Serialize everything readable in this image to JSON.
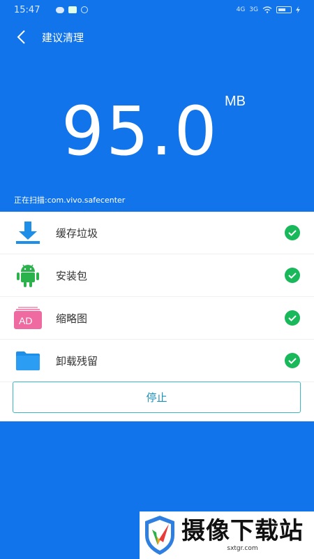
{
  "status_bar": {
    "time": "15:47",
    "net1": "4G",
    "net2": "3G"
  },
  "header": {
    "title": "建议清理"
  },
  "scan": {
    "size_value": "95.0",
    "size_unit": "MB",
    "status_text": "正在扫描:com.vivo.safecenter"
  },
  "items": [
    {
      "label": "缓存垃圾",
      "icon": "download-icon"
    },
    {
      "label": "安装包",
      "icon": "android-icon"
    },
    {
      "label": "缩略图",
      "icon": "ad-thumbnail-icon",
      "icon_text": "AD"
    },
    {
      "label": "卸载残留",
      "icon": "folder-icon"
    }
  ],
  "stop_button": {
    "label": "停止"
  },
  "watermark": {
    "title": "摄像下载站",
    "url": "sxtgr.com"
  },
  "colors": {
    "primary": "#1274ea",
    "check": "#19b85a",
    "button_border": "#38b7c5"
  }
}
